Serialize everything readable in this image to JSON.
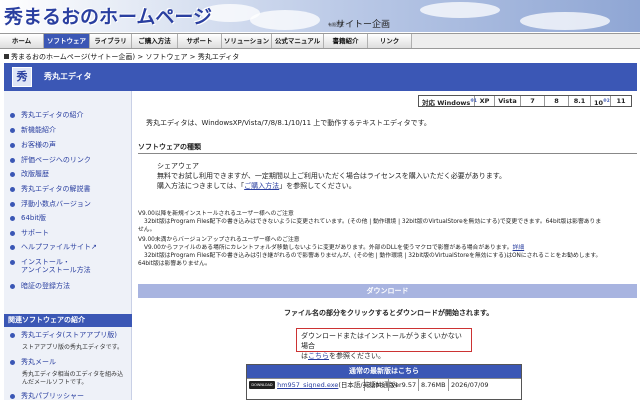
{
  "header": {
    "site_title": "秀まるおのホームページ",
    "company_prefix": "有限会社",
    "company_name": "サイトー企画"
  },
  "nav": {
    "items": [
      {
        "label": "ホーム"
      },
      {
        "label": "ソフトウェア",
        "active": true
      },
      {
        "label": "ライブラリ"
      },
      {
        "label": "ご購入方法"
      },
      {
        "label": "サポート"
      },
      {
        "label": "ソリューション"
      },
      {
        "label": "公式マニュアル"
      },
      {
        "label": "書籍紹介"
      },
      {
        "label": "リンク"
      }
    ]
  },
  "breadcrumb": {
    "home": "秀まるおのホームページ(サイトー企画)",
    "sep1": " > ",
    "software": "ソフトウェア",
    "sep2": " > ",
    "current": "秀丸エディタ"
  },
  "titlebar": {
    "icon_glyph": "秀",
    "title": "秀丸エディタ"
  },
  "sidebar": {
    "items": [
      {
        "label": "秀丸エディタの紹介"
      },
      {
        "label": "新機能紹介"
      },
      {
        "label": "お客様の声"
      },
      {
        "label": "評価ページへのリンク"
      },
      {
        "label": "改版履歴"
      },
      {
        "label": "秀丸エディタの解説書"
      },
      {
        "label": "浮動小数点バージョン"
      },
      {
        "label": "64bit版"
      },
      {
        "label": "サポート"
      },
      {
        "label": "ヘルプファイルサイト↗"
      },
      {
        "label": "インストール・",
        "label2": "アンインストール方法"
      },
      {
        "label": "暗証の登録方法"
      }
    ],
    "related_heading": "関連ソフトウェアの紹介",
    "related": [
      {
        "label": "秀丸エディタ(ストアアプリ版)",
        "desc": "ストアアプリ版の秀丸エディタです。"
      },
      {
        "label": "秀丸メール",
        "desc": "秀丸エディタ相当のエディタを組み込",
        "desc2": "んだメールソフトです。"
      },
      {
        "label": "秀丸パブリッシャー"
      }
    ]
  },
  "compat": {
    "label": "対応 Windows",
    "label_mark": "※1",
    "versions": [
      "XP",
      "Vista",
      "7",
      "8",
      "8.1",
      "10",
      "11"
    ],
    "ten_mark": "※2"
  },
  "main": {
    "intro": "秀丸エディタは、WindowsXP/Vista/7/8/8.1/10/11 上で動作するテキストエディタです。",
    "section_heading": "ソフトウェアの種類",
    "type_name": "シェアウェア",
    "type_desc": "無料でお試し利用できますが、一定期間以上ご利用いただく場合はライセンスを購入いただく必要があります。",
    "buy_prefix": "購入方法につきましては、「",
    "buy_link": "ご購入方法",
    "buy_suffix": "」を参照してください。",
    "note1_title": "V9.00以降を新規インストールされるユーザー様へのご注意",
    "note1_line1": "32bit版はProgram Files配下の書き込みはできないように変更されています。(その他 | 動作環境 | 32bit版のVirtualStoreを無効にする)で変更できます。64bit版は影響ありま",
    "note1_line2": "せん。",
    "note2_title": "V9.00未満からバージョンアップされるユーザー様へのご注意",
    "note2_line1": "V9.00からファイルのある場所にカレントフォルダ移動しないように変更があります。外部のDLLを使うマクロで影響がある場合があります。",
    "note2_link": "詳細",
    "note2_line2": "32bit版はProgram Files配下の書き込みは引き継がれるので影響ありませんが、(その他 | 動作環境 | 32bit版のVirtualStoreを無効にする)はONにされることをお勧めします。",
    "note2_line3": "64bit版は影響ありません。",
    "download_heading": "ダウンロード",
    "download_instr": "ファイル名の部分をクリックするとダウンロードが開始されます。",
    "notice_line1": "ダウンロードまたはインストールがうまくいかない場合",
    "notice_prefix": "は",
    "notice_link": "こちら",
    "notice_suffix": "を参照ください。",
    "latest_heading": "通常の最新版はこちら",
    "latest_file": "hm957_signed.exe",
    "latest_lang": "(日本語/英語共通版)",
    "latest_bits": "32bit",
    "latest_ver": "Ver9.57",
    "latest_size": "8.76MB",
    "latest_date": "2026/07/09",
    "dl_icon_text": "DOWNLOAD"
  }
}
